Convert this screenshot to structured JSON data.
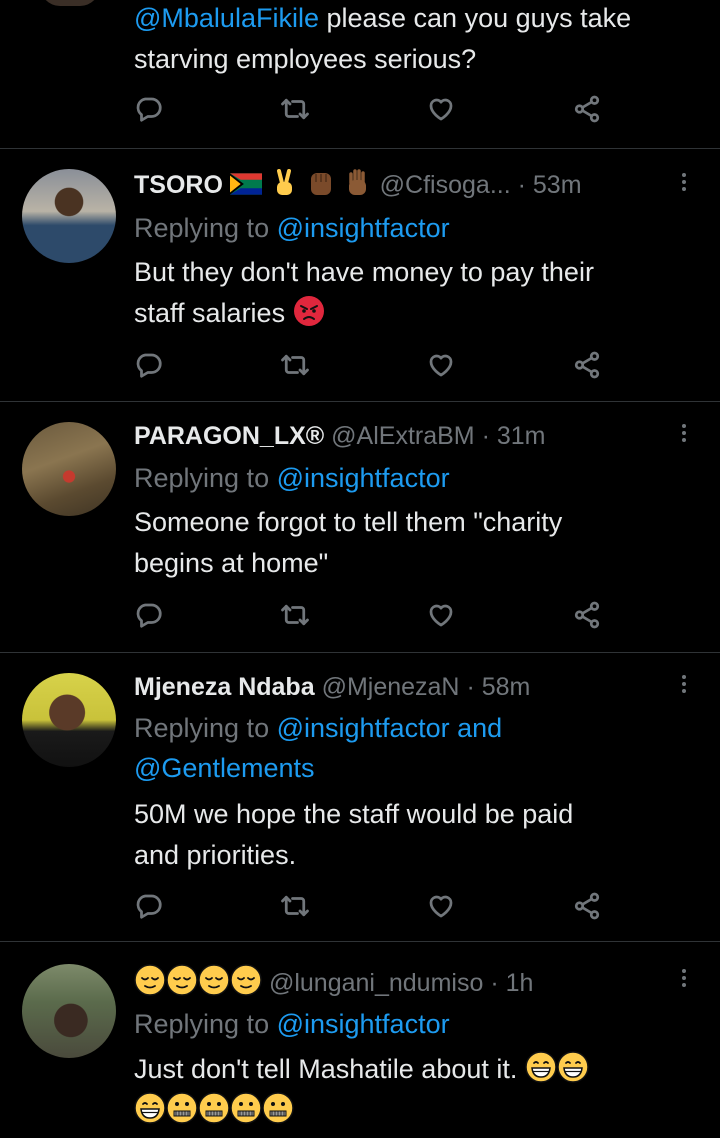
{
  "top_tweet": {
    "text_mention": "@MbalulaFikile",
    "text_rest_line1": " please can you guys take",
    "text_line2": "starving employees serious?"
  },
  "tweets": [
    {
      "name": "TSORO",
      "handle": "@Cfisoga...",
      "time": "· 53m",
      "replying_prefix": "Replying to ",
      "replying_to": "@insightfactor",
      "replying_extra": "",
      "body_line1": "But they don't have money to pay their",
      "body_line2": "staff salaries",
      "body_emoji": "pouting-face"
    },
    {
      "name": "PARAGON_LX®",
      "handle": "@AlExtraBM",
      "time": "· 31m",
      "replying_prefix": "Replying to ",
      "replying_to": "@insightfactor",
      "body_line1": "Someone forgot to tell them \"charity",
      "body_line2": "begins at home\""
    },
    {
      "name": "Mjeneza Ndaba",
      "handle": "@MjenezaN",
      "time": "· 58m",
      "replying_prefix": "Replying to ",
      "replying_to": "@insightfactor and",
      "replying_to_line2": "@Gentlements",
      "body_line1": "50M we hope the staff would be paid",
      "body_line2": "and priorities."
    },
    {
      "name": "",
      "name_emoji": "relieved-face x4",
      "handle": "@lungani_ndumiso",
      "time": "· 1h",
      "replying_prefix": "Replying to ",
      "replying_to": "@insightfactor",
      "body_line1": "Just don't tell Mashatile about it.",
      "body_emoji_line1": "grinning-face x2",
      "body_emoji_line2": "grinning-face, zipper-mouth-face x4"
    }
  ],
  "actions": {
    "reply_icon": "reply-icon",
    "retweet_icon": "retweet-icon",
    "like_icon": "heart-icon",
    "share_icon": "share-icon"
  },
  "colors": {
    "background": "#000000",
    "text": "#e7e9ea",
    "secondary": "#71767b",
    "link": "#1d9bf0",
    "divider": "#2f3336"
  }
}
